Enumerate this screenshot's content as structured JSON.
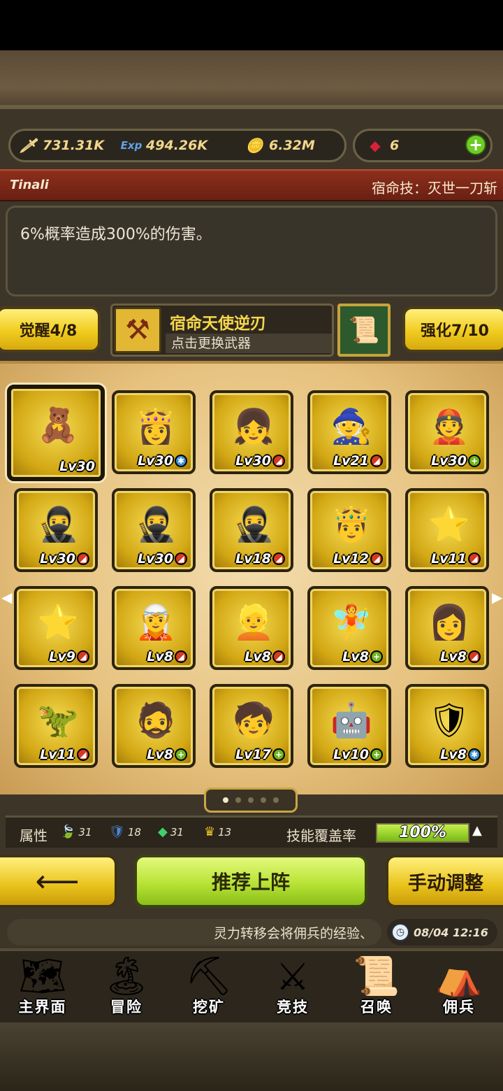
{
  "resources": {
    "attack": {
      "icon": "sword-icon",
      "value": "731.31K"
    },
    "exp": {
      "icon": "exp-icon",
      "value": "494.26K"
    },
    "gold": {
      "icon": "gold-coin-icon",
      "value": "6.32M"
    },
    "gems": {
      "icon": "ruby-icon",
      "value": "6"
    }
  },
  "hero": {
    "name": "Tinali",
    "fate_skill": "宿命技：灭世一刀斩",
    "description": "6%概率造成300%的伤害。"
  },
  "weapon": {
    "awaken_label": "觉醒4/8",
    "name": "宿命天使逆刃",
    "hint": "点击更换武器",
    "enhance_label": "强化7/10"
  },
  "grid": [
    {
      "sprite": "🧸",
      "level": "Lv30",
      "badge": "",
      "selected": true
    },
    {
      "sprite": "👸",
      "level": "Lv30",
      "badge": "blue"
    },
    {
      "sprite": "👧",
      "level": "Lv30",
      "badge": "red"
    },
    {
      "sprite": "🧙",
      "level": "Lv21",
      "badge": "red"
    },
    {
      "sprite": "👲",
      "level": "Lv30",
      "badge": "green"
    },
    {
      "sprite": "🥷",
      "level": "Lv30",
      "badge": "red"
    },
    {
      "sprite": "🥷",
      "level": "Lv30",
      "badge": "red"
    },
    {
      "sprite": "🥷",
      "level": "Lv18",
      "badge": "red"
    },
    {
      "sprite": "🤴",
      "level": "Lv12",
      "badge": "red"
    },
    {
      "sprite": "⭐",
      "level": "Lv11",
      "badge": "red"
    },
    {
      "sprite": "⭐",
      "level": "Lv9",
      "badge": "red"
    },
    {
      "sprite": "🧝",
      "level": "Lv8",
      "badge": "red"
    },
    {
      "sprite": "👱",
      "level": "Lv8",
      "badge": "red"
    },
    {
      "sprite": "🧚",
      "level": "Lv8",
      "badge": "green"
    },
    {
      "sprite": "👩",
      "level": "Lv8",
      "badge": "red"
    },
    {
      "sprite": "🦖",
      "level": "Lv11",
      "badge": "red"
    },
    {
      "sprite": "🧔",
      "level": "Lv8",
      "badge": "green"
    },
    {
      "sprite": "🧒",
      "level": "Lv17",
      "badge": "green"
    },
    {
      "sprite": "🤖",
      "level": "Lv10",
      "badge": "green"
    },
    {
      "sprite": "🛡",
      "level": "Lv8",
      "badge": "blue"
    }
  ],
  "pagination": {
    "pages": 5,
    "current": 0
  },
  "stats": {
    "label": "属性",
    "items": [
      {
        "icon": "leaf-icon",
        "value": "31"
      },
      {
        "icon": "shield-icon",
        "value": "18"
      },
      {
        "icon": "gem-icon",
        "value": "31"
      },
      {
        "icon": "crown-icon",
        "value": "13"
      }
    ],
    "coverage_label": "技能覆盖率",
    "coverage_value": "100%",
    "coverage_fraction": 1.0
  },
  "actions": {
    "back_icon": "arrow-left-icon",
    "recommend": "推荐上阵",
    "manual": "手动调整"
  },
  "ticker": {
    "text": "灵力转移会将佣兵的经验、",
    "time": "08/04 12:16"
  },
  "nav": [
    {
      "icon": "map-icon",
      "label": "主界面"
    },
    {
      "icon": "island-icon",
      "label": "冒险"
    },
    {
      "icon": "pickaxe-icon",
      "label": "挖矿"
    },
    {
      "icon": "crossed-swords-icon",
      "label": "竞技"
    },
    {
      "icon": "scroll-icon",
      "label": "召唤"
    },
    {
      "icon": "tent-icon",
      "label": "佣兵"
    }
  ]
}
